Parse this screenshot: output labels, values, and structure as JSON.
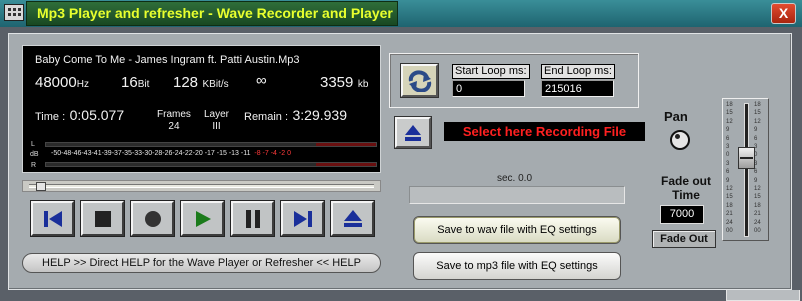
{
  "window": {
    "title": "Mp3 Player and refresher - Wave Recorder and Player",
    "close_glyph": "X"
  },
  "display": {
    "track_title": "Baby Come To Me - James Ingram ft. Patti Austin.Mp3",
    "sample_rate": "48000",
    "sample_rate_unit": "Hz",
    "bits": "16",
    "bits_unit": "Bit",
    "bitrate": "128",
    "bitrate_unit": "KBit/s",
    "stereo_symbol": "∞",
    "size": "3359",
    "size_unit": "kb",
    "time_label": "Time :",
    "time_value": "0:05.077",
    "frames_label": "Frames",
    "frames_value": "24",
    "layer_label": "Layer",
    "layer_value": "III",
    "remain_label": "Remain :",
    "remain_value": "3:29.939",
    "meter_left": "L",
    "meter_db": "dB",
    "meter_right": "R",
    "meter_scale": "-50-48-46-43-41-39-37-35-33-30-28-26-24-22-20 -17 -15 -13 -11",
    "meter_scale_red": "-8  -7  -4  -2  0"
  },
  "seek": {
    "position": 0.02
  },
  "transport": {
    "buttons": [
      "previous-icon",
      "stop-icon",
      "record-icon",
      "play-icon",
      "pause-icon",
      "next-icon",
      "eject-icon"
    ]
  },
  "help": {
    "label": "HELP  >>  Direct HELP for the Wave Player or Refresher  <<  HELP"
  },
  "loop": {
    "start_label": "Start Loop ms:",
    "start_value": "0",
    "end_label": "End Loop ms:",
    "end_value": "215016"
  },
  "recording": {
    "select_label": "Select here Recording File",
    "sec_text": "sec. 0.0",
    "save_wav_label": "Save to wav file with EQ settings",
    "save_mp3_label": "Save to mp3 file with EQ settings"
  },
  "pan": {
    "label": "Pan"
  },
  "fade": {
    "label_line1": "Fade out",
    "label_line2": "Time",
    "value": "7000",
    "button_label": "Fade Out"
  },
  "volume": {
    "level": 0.62
  },
  "colors": {
    "title_text": "#e8ff2e",
    "record_label": "#ff2020",
    "transport_icon": "#1a2f9a",
    "play_icon": "#1b7b1b"
  }
}
